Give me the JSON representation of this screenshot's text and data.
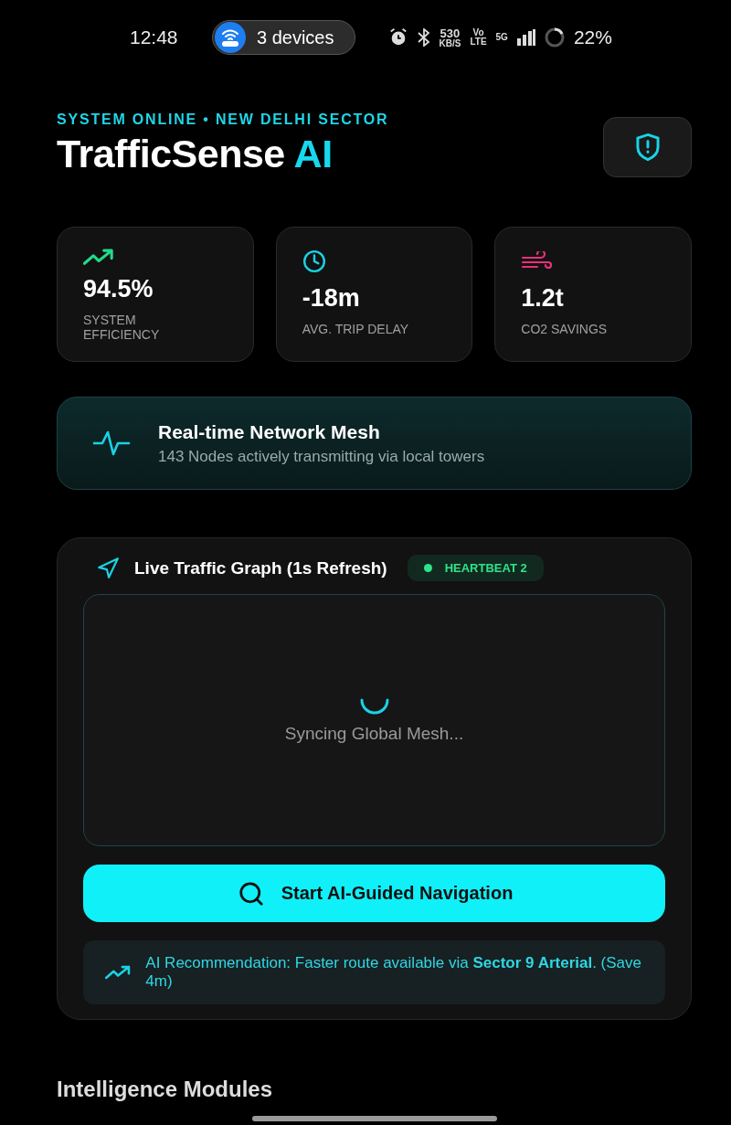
{
  "status_bar": {
    "time": "12:48",
    "hotspot": "3 devices",
    "speed": "530",
    "speed_unit": "KB/S",
    "volte_top": "Vo",
    "volte_bottom": "LTE",
    "network": "5G",
    "battery": "22%"
  },
  "header": {
    "eyebrow": "SYSTEM ONLINE • NEW DELHI SECTOR",
    "title": "TrafficSense",
    "title_accent": "AI"
  },
  "stats": [
    {
      "kind": "trend",
      "color": "#22d98a",
      "value": "94.5%",
      "label": "SYSTEM EFFICIENCY"
    },
    {
      "kind": "clock",
      "color": "#19d3e6",
      "value": "-18m",
      "label": "AVG. TRIP DELAY"
    },
    {
      "kind": "wind",
      "color": "#ec2f7a",
      "value": "1.2t",
      "label": "CO2 SAVINGS"
    }
  ],
  "mesh": {
    "title": "Real-time Network Mesh",
    "subtitle": "143 Nodes actively transmitting via local towers"
  },
  "graph": {
    "title": "Live Traffic Graph (1s Refresh)",
    "badge": "HEARTBEAT 2",
    "status": "Syncing Global Mesh..."
  },
  "action": {
    "label": "Start AI-Guided Navigation"
  },
  "recommendation": "AI Recommendation: Faster route available via **Sector 9 Arterial**. (Save 4m)",
  "section_title": "Intelligence Modules"
}
